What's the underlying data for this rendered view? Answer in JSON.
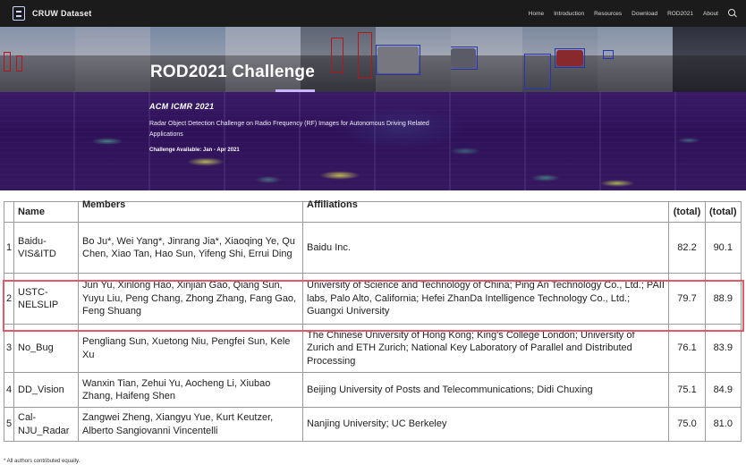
{
  "nav": {
    "brand": "CRUW Dataset",
    "links": [
      "Home",
      "Introduction",
      "Resources",
      "Download",
      "ROD2021",
      "About"
    ],
    "search_icon": "search-icon"
  },
  "hero": {
    "title": "ROD2021 Challenge",
    "event": "ACM ICMR 2021",
    "description": "Radar Object Detection Challenge on Radio Frequency (RF) Images for Autonomous Driving Related Applications",
    "availability": "Challenge Available: Jan - Apr 2021",
    "colors": {
      "radar_bg": "#2e1158",
      "accent": "#c9b8ff"
    }
  },
  "table": {
    "headers": {
      "name": "Name",
      "members": "Members",
      "affiliations": "Affiliations",
      "score1": "(total)",
      "score2": "(total)"
    },
    "rows": [
      {
        "rank": "1",
        "name": "Baidu-VIS&ITD",
        "members": "Bo Ju*, Wei Yang*, Jinrang Jia*, Xiaoqing Ye, Qu Chen, Xiao Tan, Hao Sun, Yifeng Shi, Errui Ding",
        "affiliations": "Baidu Inc.",
        "score1": "82.2",
        "score2": "90.1"
      },
      {
        "rank": "2",
        "name": "USTC-NELSLIP",
        "members": "Jun Yu, Xinlong Hao, Xinjian Gao, Qiang Sun, Yuyu Liu, Peng Chang, Zhong Zhang, Fang Gao, Feng Shuang",
        "affiliations": "University of Science and Technology of China; Ping An Technology Co., Ltd.; PAII labs, Palo Alto, California; Hefei ZhanDa Intelligence Technology Co., Ltd.; Guangxi University",
        "score1": "79.7",
        "score2": "88.9"
      },
      {
        "rank": "3",
        "name": "No_Bug",
        "members": "Pengliang Sun, Xuetong Niu, Pengfei Sun, Kele Xu",
        "affiliations": "The Chinese University of Hong Kong; King's College London; University of Zurich and ETH Zurich; National Key Laboratory of Parallel and Distributed Processing",
        "score1": "76.1",
        "score2": "83.9"
      },
      {
        "rank": "4",
        "name": "DD_Vision",
        "members": "Wanxin Tian, Zehui Yu, Aocheng Li, Xiubao Zhang, Haifeng Shen",
        "affiliations": "Beijing University of Posts and Telecommunications; Didi Chuxing",
        "score1": "75.1",
        "score2": "84.9"
      },
      {
        "rank": "5",
        "name": "Cal-NJU_Radar",
        "members": "Zangwei Zheng, Xiangyu Yue, Kurt Keutzer, Alberto Sangiovanni Vincentelli",
        "affiliations": "Nanjing University; UC Berkeley",
        "score1": "75.0",
        "score2": "81.0"
      }
    ],
    "highlight_color": "#e05a6a"
  },
  "footnote": "* All authors contributed equally."
}
